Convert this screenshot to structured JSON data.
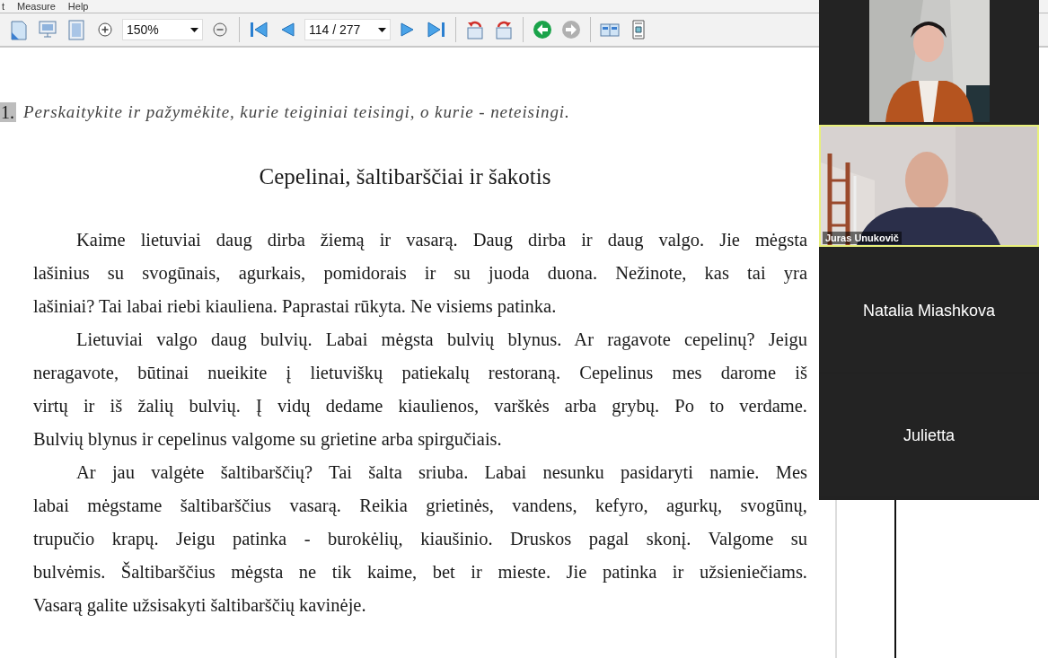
{
  "menu_bar": [
    "t",
    "Measure",
    "Help"
  ],
  "toolbar": [
    {
      "kind": "icon"
    },
    {
      "kind": "icon"
    },
    {
      "kind": "icon"
    },
    {
      "kind": "icon"
    },
    {
      "kind": "dropdown",
      "value": "150%"
    },
    {
      "kind": "icon"
    },
    {
      "kind": "separator"
    },
    {
      "kind": "icon"
    },
    {
      "kind": "icon"
    },
    {
      "kind": "dropdown",
      "value": "114 / 277"
    },
    {
      "kind": "icon"
    },
    {
      "kind": "icon"
    },
    {
      "kind": "separator"
    },
    {
      "kind": "icon"
    },
    {
      "kind": "icon"
    },
    {
      "kind": "separator"
    },
    {
      "kind": "icon",
      "disabled": false
    },
    {
      "kind": "icon",
      "disabled": true
    },
    {
      "kind": "separator"
    },
    {
      "kind": "icon"
    },
    {
      "kind": "icon"
    }
  ],
  "document": {
    "exercise_number": "1.",
    "instruction": "Perskaitykite ir pažymėkite, kurie teiginiai teisingi, o kurie - neteisingi.",
    "title": "Cepelinai, šaltibarščiai ir šakotis",
    "paragraphs": [
      [
        "Kaime lietuviai daug dirba žiemą ir vasarą. Daug dirba ir daug valgo. Jie mėgsta",
        "lašinius su svogūnais, agurkais, pomidorais ir su juoda duona. Nežinote, kas tai yra",
        "lašiniai? Tai labai riebi kiauliena. Paprastai rūkyta. Ne visiems patinka."
      ],
      [
        "Lietuviai valgo daug bulvių. Labai mėgsta bulvių blynus. Ar ragavote cepelinų? Jeigu",
        "neragavote, būtinai nueikite į lietuviškų patiekalų restoraną. Cepelinus mes darome iš",
        "virtų ir iš žalių bulvių. Į vidų dedame kiaulienos, varškės arba grybų. Po to verdame.",
        "Bulvių blynus ir cepelinus valgome su grietine arba spirgučiais."
      ],
      [
        "Ar jau valgėte šaltibarščių? Tai šalta sriuba. Labai nesunku pasidaryti namie. Mes",
        "labai mėgstame šaltibarščius vasarą. Reikia grietinės, vandens, kefyro, agurkų, svogūnų,",
        "trupučio krapų. Jeigu patinka - burokėlių, kiaušinio. Druskos pagal skonį. Valgome su",
        "bulvėmis. Šaltibarščius mėgsta ne tik kaime, bet ir mieste. Jie patinka ir užsieniečiams.",
        "Vasarą galite užsisakyti šaltibarščių kavinėje."
      ]
    ]
  },
  "participants": [
    {
      "kind": "video",
      "selected": false
    },
    {
      "kind": "video",
      "name": "Juras Unukovič",
      "selected": true
    },
    {
      "kind": "name",
      "name": "Natalia Miashkova",
      "selected": false
    },
    {
      "kind": "name",
      "name": "Julietta",
      "selected": false
    }
  ]
}
